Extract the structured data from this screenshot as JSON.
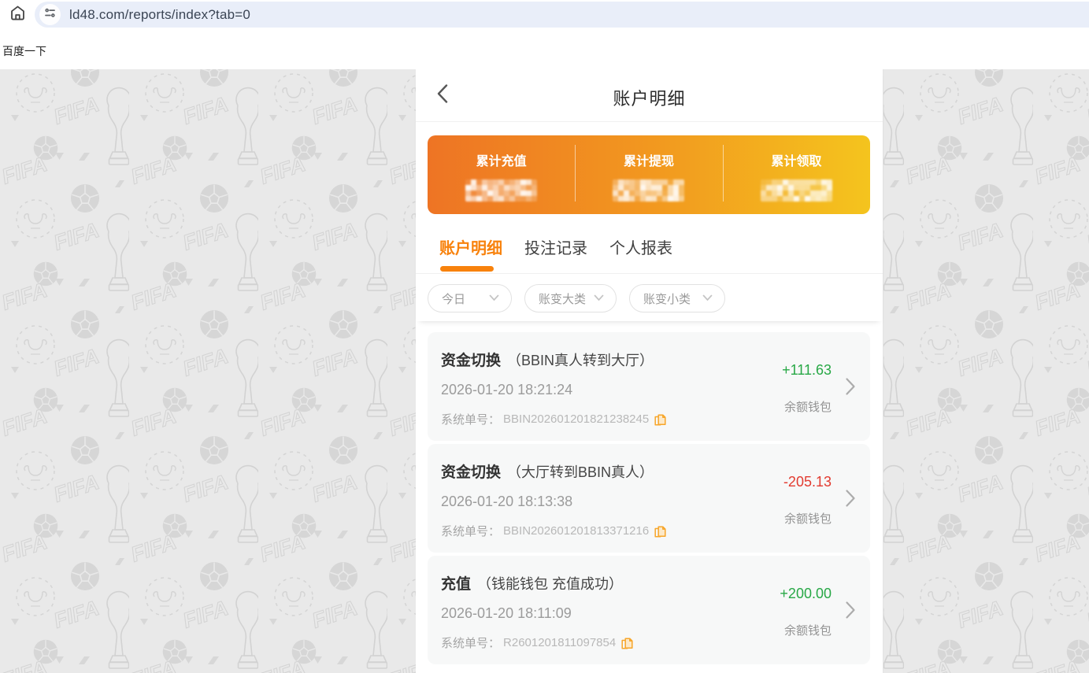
{
  "browser": {
    "url": "ld48.com/reports/index?tab=0",
    "baidu_link": "百度一下"
  },
  "page": {
    "title": "账户明细",
    "summary": {
      "items": [
        {
          "label": "累计充值",
          "value_redacted": true
        },
        {
          "label": "累计提现",
          "value_redacted": true
        },
        {
          "label": "累计领取",
          "value_redacted": true
        }
      ]
    },
    "tabs": [
      {
        "label": "账户明细",
        "active": true
      },
      {
        "label": "投注记录",
        "active": false
      },
      {
        "label": "个人报表",
        "active": false
      }
    ],
    "filters": [
      {
        "label": "今日"
      },
      {
        "label": "账变大类"
      },
      {
        "label": "账变小类"
      }
    ],
    "transactions": [
      {
        "type": "资金切换",
        "detail": "（BBIN真人转到大厅）",
        "datetime": "2026-01-20 18:21:24",
        "order_label": "系统单号：",
        "order_no": "BBIN202601201821238245",
        "amount": "+111.63",
        "wallet": "余额钱包"
      },
      {
        "type": "资金切换",
        "detail": "（大厅转到BBIN真人）",
        "datetime": "2026-01-20 18:13:38",
        "order_label": "系统单号：",
        "order_no": "BBIN202601201813371216",
        "amount": "-205.13",
        "wallet": "余额钱包"
      },
      {
        "type": "充值",
        "detail": "（钱能钱包 充值成功）",
        "datetime": "2026-01-20 18:11:09",
        "order_label": "系统单号：",
        "order_no": "R2601201811097854",
        "amount": "+200.00",
        "wallet": "余额钱包"
      }
    ]
  },
  "colors": {
    "accent": "#f8820c",
    "gradient_start": "#ee7424",
    "gradient_end": "#f4c41e",
    "positive": "#28a846",
    "negative": "#e23b30",
    "copy_icon": "#f7a62a"
  }
}
